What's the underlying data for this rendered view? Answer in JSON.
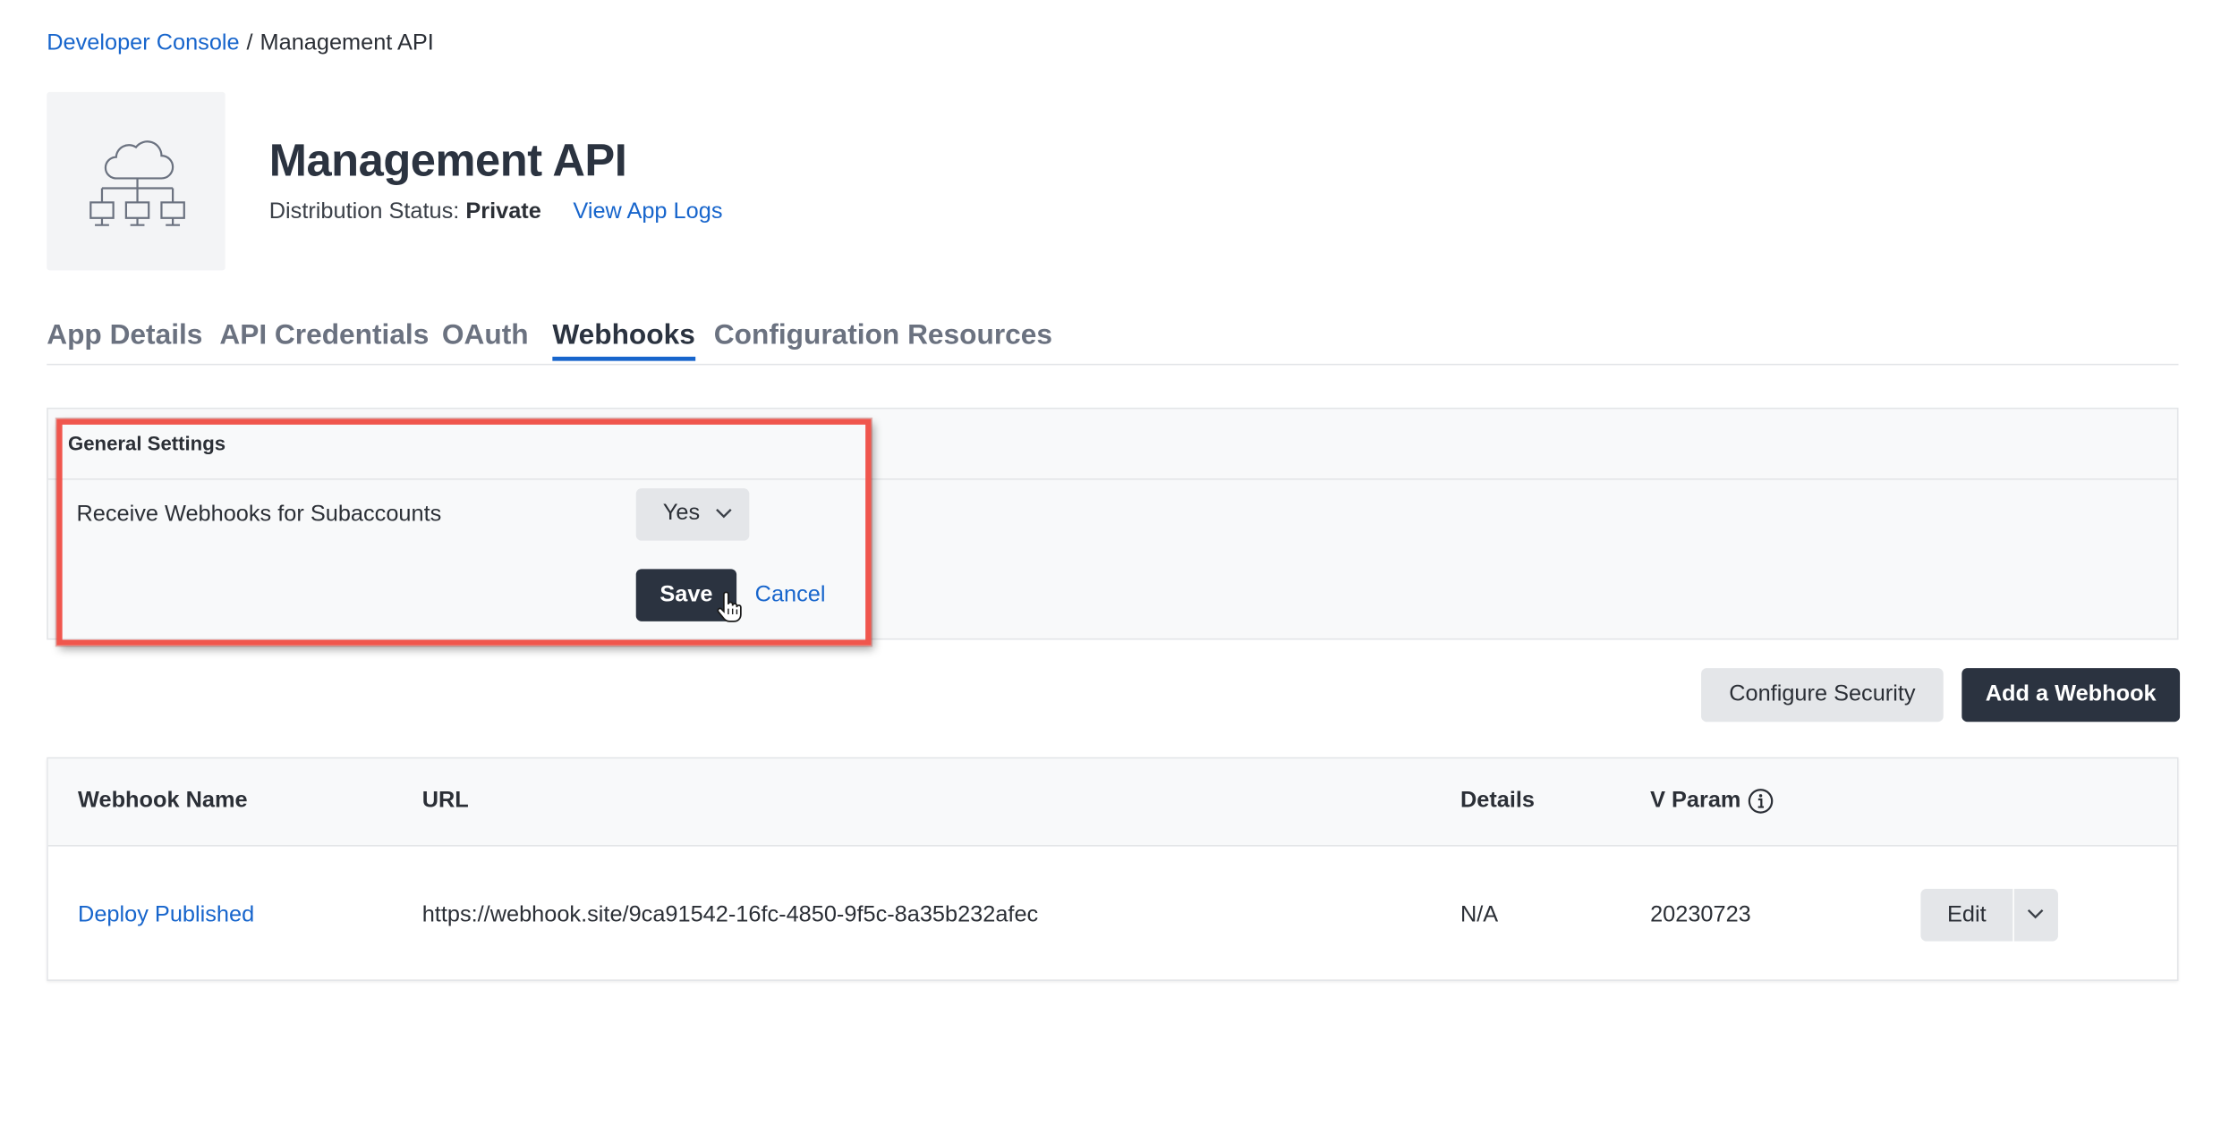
{
  "breadcrumb": {
    "link": "Developer Console",
    "separator": "/",
    "current": "Management API"
  },
  "app": {
    "icon": "cloud-network-icon",
    "title": "Management API",
    "status_label": "Distribution Status:",
    "status_value": "Private",
    "logs_link": "View App Logs"
  },
  "tabs": [
    {
      "label": "App Details",
      "active": false
    },
    {
      "label": "API Credentials",
      "active": false
    },
    {
      "label": "OAuth",
      "active": false
    },
    {
      "label": "Webhooks",
      "active": true
    },
    {
      "label": "Configuration Resources",
      "active": false
    }
  ],
  "general_settings": {
    "title": "General Settings",
    "subaccounts_label": "Receive Webhooks for Subaccounts",
    "subaccounts_value": "Yes",
    "save_label": "Save",
    "cancel_label": "Cancel"
  },
  "actions": {
    "configure_security": "Configure Security",
    "add_webhook": "Add a Webhook"
  },
  "table": {
    "columns": [
      "Webhook Name",
      "URL",
      "Details",
      "V Param"
    ],
    "rows": [
      {
        "name": "Deploy Published",
        "url": "https://webhook.site/9ca91542-16fc-4850-9f5c-8a35b232afec",
        "details": "N/A",
        "v_param": "20230723",
        "edit_label": "Edit"
      }
    ]
  },
  "colors": {
    "accent": "#1765cc",
    "primary_button": "#2b3340",
    "highlight": "#f0564d"
  }
}
